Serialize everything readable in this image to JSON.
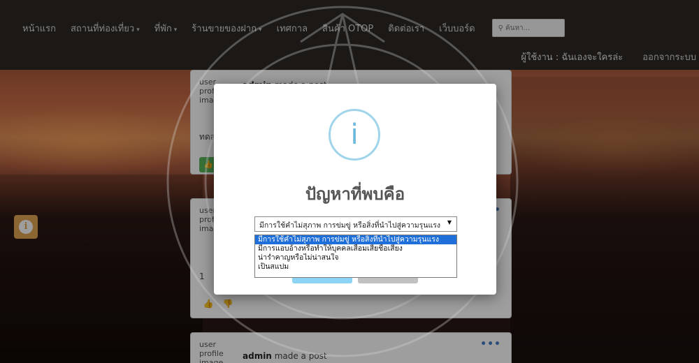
{
  "nav": {
    "items": [
      {
        "label": "หน้าแรก",
        "dropdown": false
      },
      {
        "label": "สถานที่ท่องเที่ยว",
        "dropdown": true
      },
      {
        "label": "ที่พัก",
        "dropdown": true
      },
      {
        "label": "ร้านขายของฝาก",
        "dropdown": true
      },
      {
        "label": "เทศกาล",
        "dropdown": false
      },
      {
        "label": "สินค้า OTOP",
        "dropdown": false
      },
      {
        "label": "ติดต่อเรา",
        "dropdown": false
      },
      {
        "label": "เว็บบอร์ด",
        "dropdown": false
      }
    ],
    "search_placeholder": "ค้นหา...",
    "user_label": "ผู้ใช้งาน : ฉันเองจะใครล่ะ",
    "logout_label": "ออกจากระบบ"
  },
  "posts": [
    {
      "avatar_alt": "user profile image",
      "author": "admin",
      "action": "made a post",
      "text": "ทดส"
    },
    {
      "avatar_alt": "user profile image",
      "count": "1"
    },
    {
      "avatar_alt": "user profile image",
      "author": "admin",
      "action": "made a post"
    }
  ],
  "modal": {
    "icon": "info-icon",
    "title": "ปัญหาที่พบคือ",
    "selected": "มีการใช้คำไม่สุภาพ การข่มขู่ หรือสิ่งที่นำไปสู่ความรุนแรง",
    "options": [
      "มีการใช้คำไม่สุภาพ การข่มขู่ หรือสิ่งที่นำไปสู่ความรุนแรง",
      "มีการแอบอ้างหรือทำให้บุคคลเสื่อมเสียชื่อเสียง",
      "น่ารำคาญหรือไม่น่าสนใจ",
      "เป็นสแปม"
    ]
  },
  "colors": {
    "navbar": "#2c2724",
    "info_button": "#e0a352",
    "modal_icon": "#9fd4ea",
    "confirm_button": "#8cd4f5",
    "cancel_button": "#c1c1c1",
    "option_highlight": "#1e6fd9"
  }
}
